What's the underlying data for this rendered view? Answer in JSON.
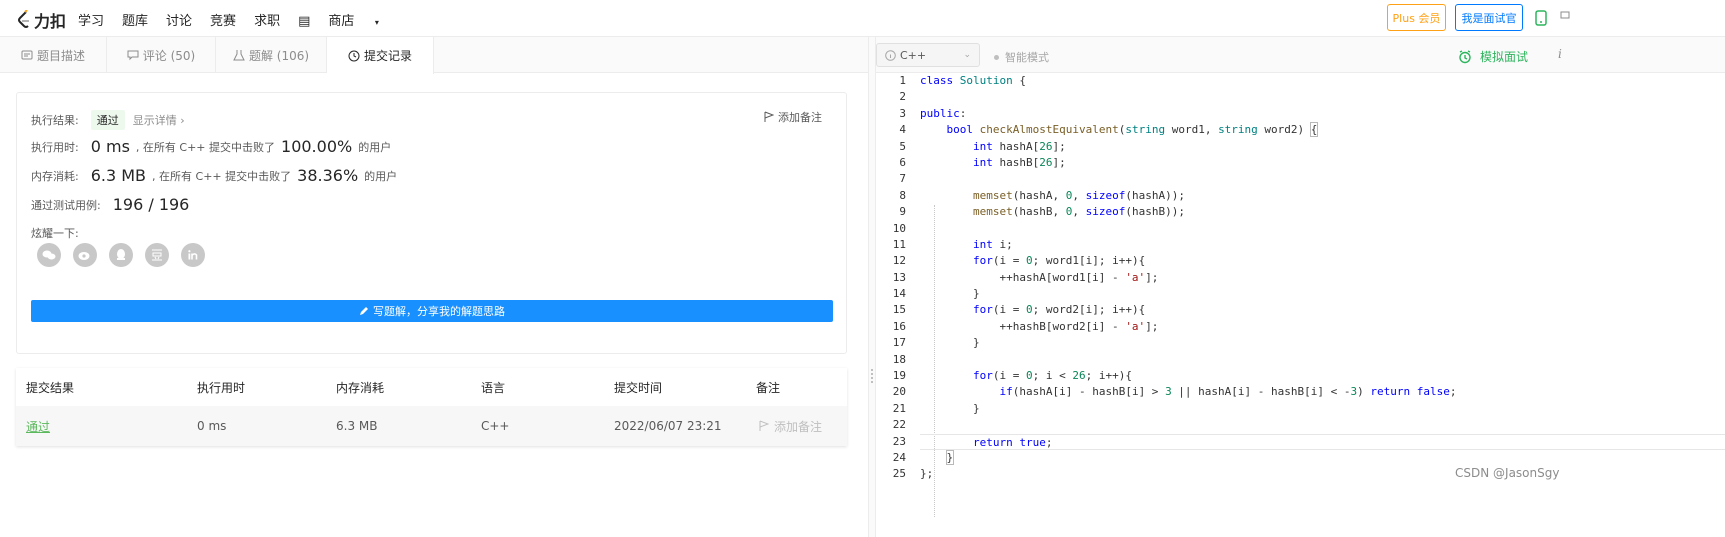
{
  "header": {
    "brand": "力扣",
    "nav": [
      "学习",
      "题库",
      "讨论",
      "竞赛",
      "求职"
    ],
    "store": "商店",
    "plus_label": "Plus 会员",
    "interviewer_label": "我是面试官"
  },
  "tabs": [
    {
      "label": "题目描述"
    },
    {
      "label": "评论 (50)"
    },
    {
      "label": "题解 (106)"
    },
    {
      "label": "提交记录"
    }
  ],
  "result": {
    "status_label": "执行结果:",
    "status": "通过",
    "details": "显示详情 ›",
    "add_note": "添加备注",
    "time_label": "执行用时:",
    "time_value": "0 ms",
    "time_text": ", 在所有 C++ 提交中击败了",
    "time_pct": "100.00%",
    "users": "的用户",
    "mem_label": "内存消耗:",
    "mem_value": "6.3 MB",
    "mem_text": ", 在所有 C++ 提交中击败了",
    "mem_pct": "38.36%",
    "cases_label": "通过测试用例:",
    "cases_value": "196 / 196",
    "share_label": "炫耀一下:",
    "share_icons": [
      "wechat-icon",
      "weibo-icon",
      "qq-icon",
      "douban-icon",
      "linkedin-icon"
    ],
    "write_button": "写题解，分享我的解题思路"
  },
  "submissions": {
    "headers": [
      "提交结果",
      "执行用时",
      "内存消耗",
      "语言",
      "提交时间",
      "备注"
    ],
    "rows": [
      {
        "result": "通过",
        "time": "0 ms",
        "memory": "6.3 MB",
        "lang": "C++",
        "submitted": "2022/06/07 23:21",
        "note": "添加备注"
      }
    ]
  },
  "editor": {
    "language": "C++",
    "smart_mode": "智能模式",
    "mock_interview": "模拟面试",
    "line_numbers": [
      "1",
      "2",
      "3",
      "4",
      "5",
      "6",
      "7",
      "8",
      "9",
      "10",
      "11",
      "12",
      "13",
      "14",
      "15",
      "16",
      "17",
      "18",
      "19",
      "20",
      "21",
      "22",
      "23",
      "24",
      "25"
    ]
  },
  "watermark": "CSDN @JasonSgy",
  "colors": {
    "accent_orange": "#ffa116",
    "blue": "#1890ff",
    "green": "#2db55d",
    "pass_green": "#5cb85c"
  }
}
